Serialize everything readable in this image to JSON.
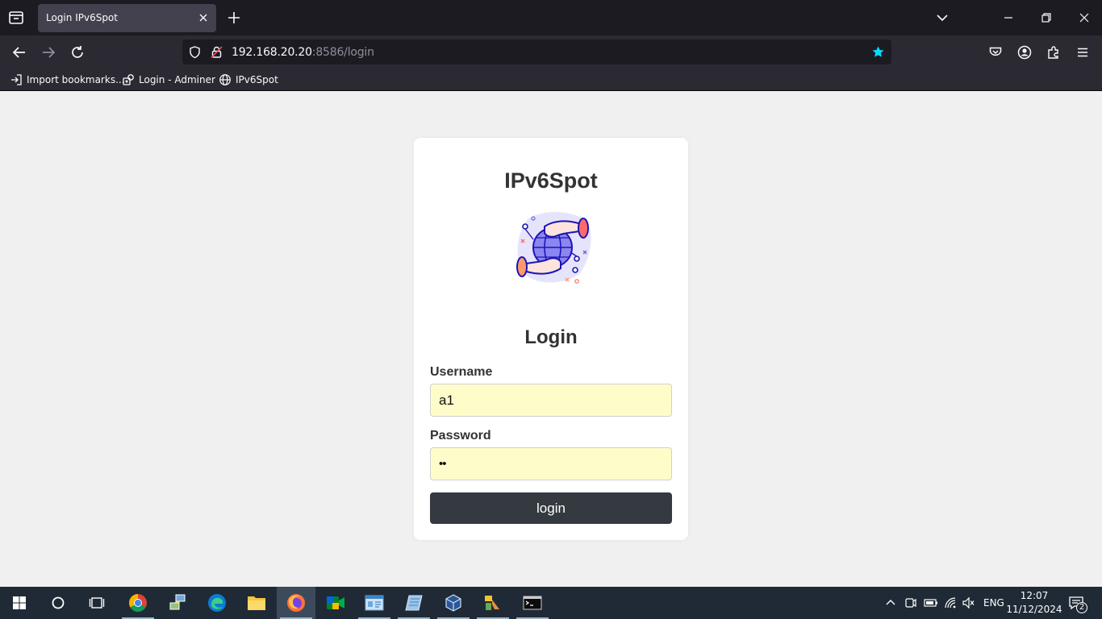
{
  "browser": {
    "tab_title": "Login IPv6Spot",
    "url_host": "192.168.20.20",
    "url_rest": ":8586/login",
    "bookmarks": [
      {
        "label": "Import bookmarks...",
        "icon": "import-icon"
      },
      {
        "label": "Login - Adminer",
        "icon": "adminer-icon"
      },
      {
        "label": "IPv6Spot",
        "icon": "globe-icon"
      }
    ]
  },
  "page": {
    "brand": "IPv6Spot",
    "heading": "Login",
    "username_label": "Username",
    "username_value": "a1",
    "password_label": "Password",
    "password_value": "••",
    "submit_label": "login"
  },
  "taskbar": {
    "lang": "ENG",
    "time": "12:07",
    "date": "11/12/2024",
    "notifications": "2"
  },
  "colors": {
    "accent_star": "#00ddff",
    "button_bg": "#343a40",
    "autofill_bg": "#fefdc9"
  }
}
